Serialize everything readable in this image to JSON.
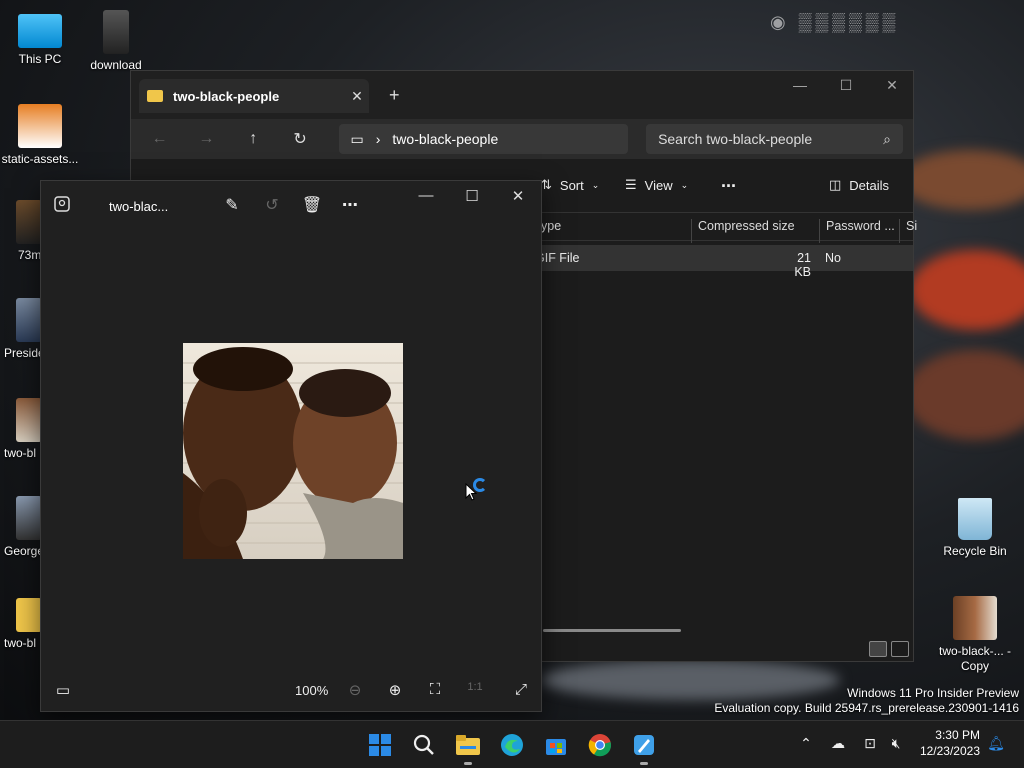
{
  "desktop": {
    "icons_left": [
      {
        "label": "This PC",
        "icon": "computer-icon"
      },
      {
        "label": "download",
        "icon": "image-thumbnail"
      },
      {
        "label": "static-assets...",
        "icon": "image-thumbnail"
      },
      {
        "label": "73m",
        "icon": "image-thumbnail"
      },
      {
        "label": "Preside",
        "icon": "image-thumbnail"
      },
      {
        "label": "two-bl",
        "icon": "image-thumbnail"
      },
      {
        "label": "George",
        "icon": "image-thumbnail"
      },
      {
        "label": "two-bl",
        "icon": "zip-folder-icon"
      }
    ],
    "icons_right": [
      {
        "label": "Recycle Bin",
        "icon": "recycle-bin-icon"
      },
      {
        "label": "two-black-... - Copy",
        "icon": "image-thumbnail"
      }
    ],
    "os_watermark": {
      "line1": "Windows 11 Pro Insider Preview",
      "line2": "Evaluation copy. Build 25947.rs_prerelease.230901-1416"
    }
  },
  "explorer": {
    "tab_title": "two-black-people",
    "address": "two-black-people",
    "search_placeholder": "Search two-black-people",
    "commands": {
      "sort": "Sort",
      "view": "View",
      "more": "...",
      "details": "Details"
    },
    "columns": [
      "ype",
      "Compressed size",
      "Password ...",
      "Si"
    ],
    "rows": [
      {
        "type": "GIF File",
        "compressed_size": "21 KB",
        "password": "No"
      }
    ]
  },
  "photos": {
    "title": "two-blac...",
    "zoom": "100%"
  },
  "taskbar": {
    "apps": [
      "start-icon",
      "search-icon",
      "file-explorer-icon",
      "edge-icon",
      "store-icon",
      "chrome-icon",
      "paint-icon"
    ],
    "time": "3:30 PM",
    "date": "12/23/2023"
  },
  "colors": {
    "accent": "#2b8ae6",
    "folder": "#f0c64a",
    "window_bg": "#1c1c1c"
  }
}
